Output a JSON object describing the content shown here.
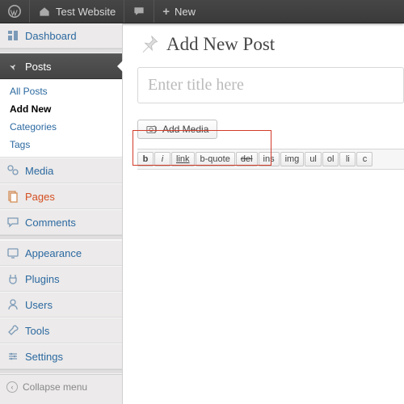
{
  "adminbar": {
    "site_title": "Test Website",
    "new_label": "New"
  },
  "sidebar": {
    "dashboard": "Dashboard",
    "posts": "Posts",
    "posts_sub": {
      "all": "All Posts",
      "add": "Add New",
      "cats": "Categories",
      "tags": "Tags"
    },
    "media": "Media",
    "pages": "Pages",
    "comments": "Comments",
    "appearance": "Appearance",
    "plugins": "Plugins",
    "users": "Users",
    "tools": "Tools",
    "settings": "Settings",
    "collapse": "Collapse menu"
  },
  "page": {
    "title": "Add New Post",
    "title_placeholder": "Enter title here",
    "add_media": "Add Media"
  },
  "toolbar": {
    "b": "b",
    "i": "i",
    "link": "link",
    "bquote": "b-quote",
    "del": "del",
    "ins": "ins",
    "img": "img",
    "ul": "ul",
    "ol": "ol",
    "li": "li",
    "c": "c"
  }
}
